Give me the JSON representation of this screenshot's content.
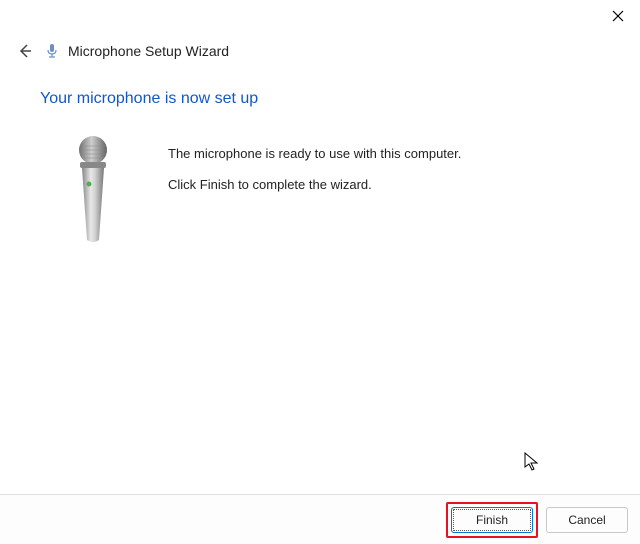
{
  "window": {
    "title": "Microphone Setup Wizard"
  },
  "heading": "Your microphone is now set up",
  "body": {
    "line1": "The microphone is ready to use with this computer.",
    "line2": "Click Finish to complete the wizard."
  },
  "buttons": {
    "finish": "Finish",
    "cancel": "Cancel"
  }
}
